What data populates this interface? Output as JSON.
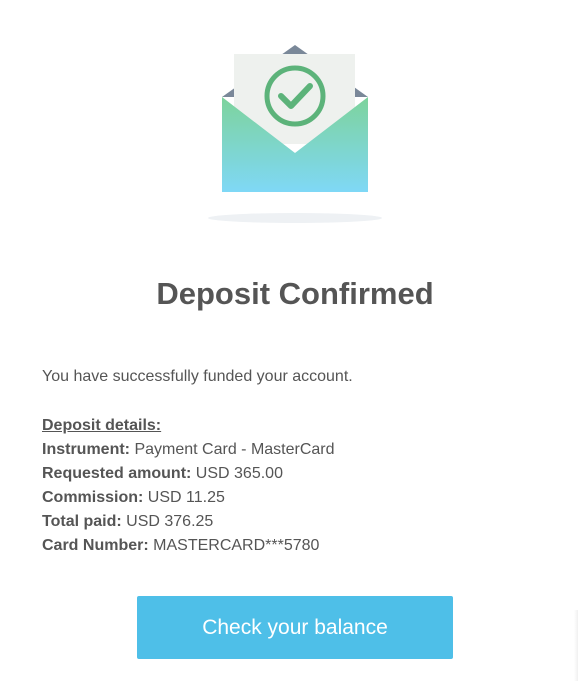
{
  "email": {
    "title": "Deposit Confirmed",
    "intro": "You have successfully funded your account.",
    "details_heading": "Deposit details:",
    "details": [
      {
        "label": "Instrument:",
        "value": "Payment Card - MasterCard"
      },
      {
        "label": "Requested amount:",
        "value": "USD 365.00"
      },
      {
        "label": "Commission:",
        "value": "USD 11.25"
      },
      {
        "label": "Total paid:",
        "value": "USD 376.25"
      },
      {
        "label": "Card Number:",
        "value": "MASTERCARD***5780"
      }
    ],
    "cta_label": "Check your balance"
  },
  "icons": {
    "illustration": "envelope-checkmark-icon"
  },
  "colors": {
    "button": "#4ebfe8",
    "text": "#555555",
    "check": "#5cb37a",
    "envelope_top": "#7dd39c",
    "envelope_bottom": "#7fd7f5"
  }
}
